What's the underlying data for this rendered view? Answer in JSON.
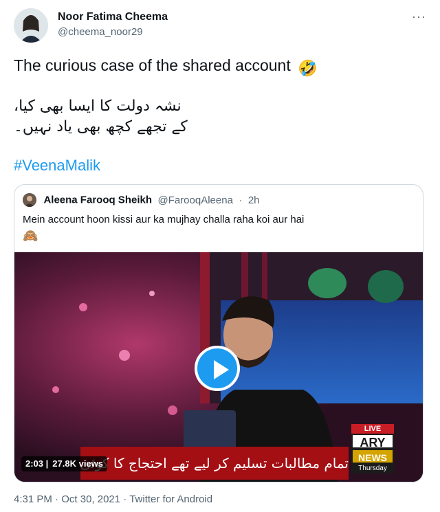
{
  "tweet": {
    "author_name": "Noor Fatima Cheema",
    "author_handle": "@cheema_noor29",
    "more_label": "···",
    "text": "The curious case of the shared account",
    "emoji": "🤣",
    "urdu_line1": "نشہ دولت کا ایسا بھی کیا،",
    "urdu_line2": "کے تجھے کچھ بھی  یاد نہیں۔",
    "hashtag": "#VeenaMalik",
    "time": "4:31 PM",
    "date": "Oct 30, 2021",
    "source": "Twitter for Android"
  },
  "quoted": {
    "author_name": "Aleena Farooq Sheikh",
    "author_handle": "@FarooqAleena",
    "time_ago": "2h",
    "text": "Mein account hoon kissi aur ka mujhay challa raha koi aur hai",
    "emoji": "🙈",
    "video": {
      "duration": "2:03",
      "views": "27.8K views",
      "ticker_text": "تمام مطالبات تسلیم کر لیے تھے احتجاج کا کوئی جواز نہیں",
      "channel_live": "LIVE",
      "channel_name": "ARY",
      "channel_news": "NEWS",
      "channel_day": "Thursday"
    }
  },
  "colors": {
    "link": "#1d9bf0",
    "secondary": "#536471",
    "border": "#cfd9de"
  }
}
